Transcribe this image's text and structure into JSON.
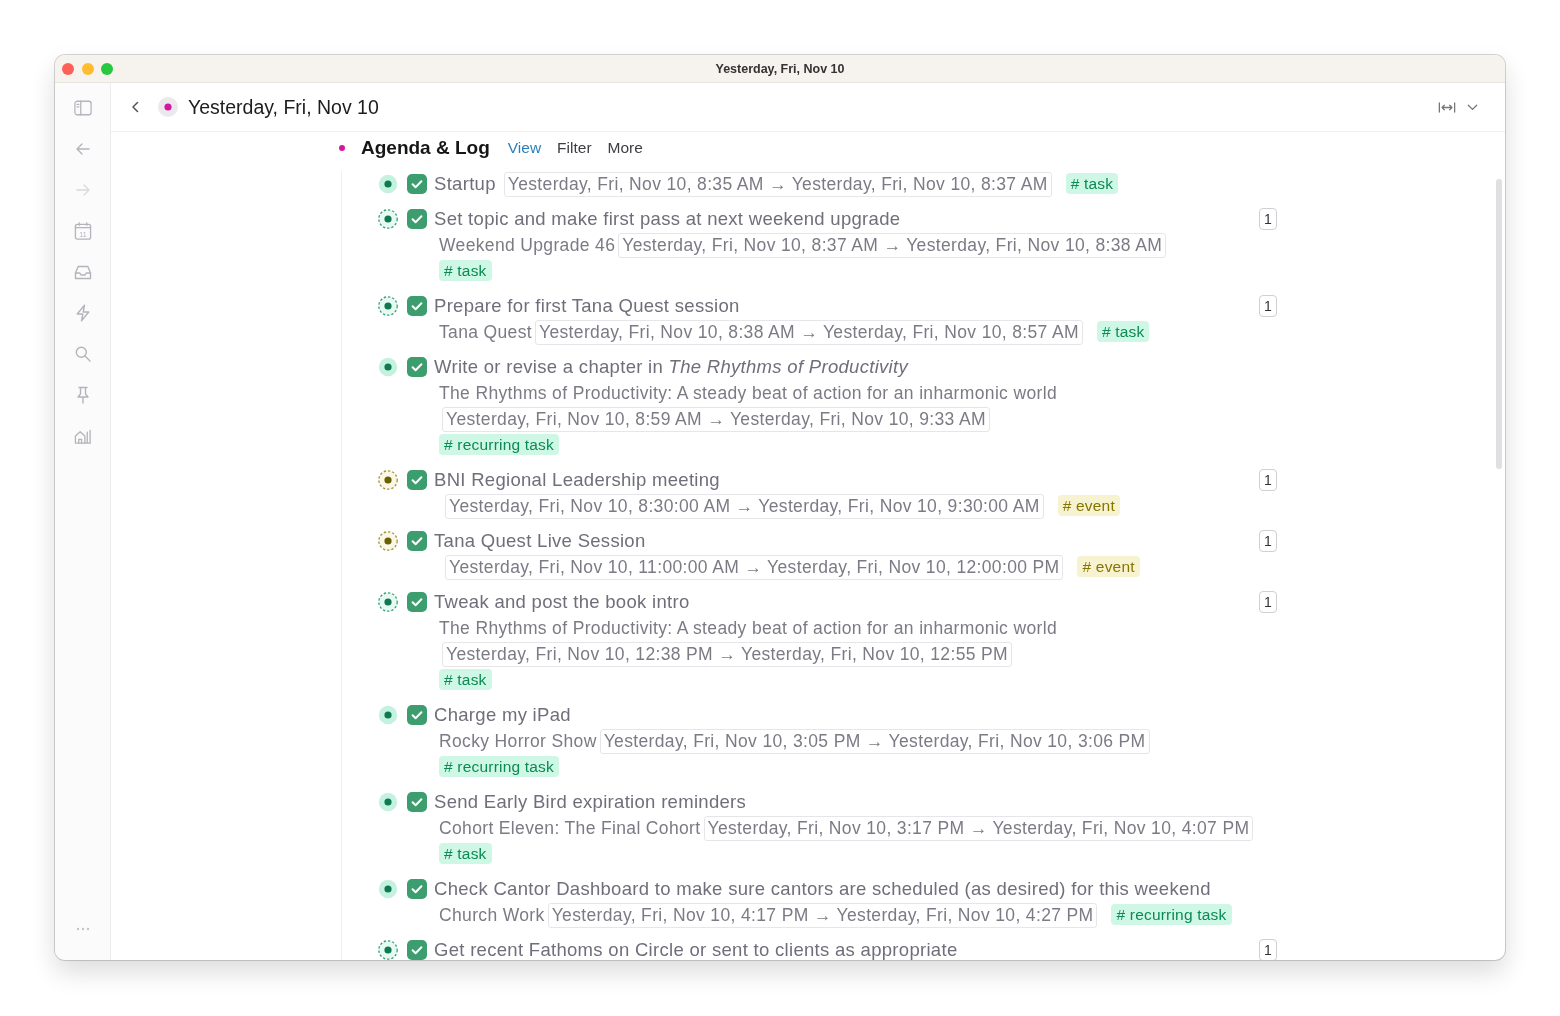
{
  "window": {
    "title": "Yesterday, Fri, Nov 10"
  },
  "sidebar": {
    "back": {
      "disabled": false
    },
    "forward": {
      "disabled": true
    },
    "calendar_day": "11"
  },
  "header": {
    "title": "Yesterday, Fri, Nov 10"
  },
  "section": {
    "title": "Agenda & Log",
    "controls": [
      {
        "label": "View",
        "selected": true
      },
      {
        "label": "Filter",
        "selected": false
      },
      {
        "label": "More",
        "selected": false
      }
    ]
  },
  "tasks": [
    {
      "bullet": {
        "kind": "filled",
        "color": "#0d7a4f"
      },
      "checked": true,
      "title": "Startup",
      "inline": [
        {
          "kind": "date",
          "text": "Yesterday, Fri, Nov 10, 8:35 AM → Yesterday, Fri, Nov 10, 8:37 AM"
        },
        {
          "kind": "tag",
          "text": "# task",
          "color": "#0b8a52"
        }
      ]
    },
    {
      "bullet": {
        "kind": "dashed",
        "color": "#0d7a4f"
      },
      "checked": true,
      "title": "Set topic and make first pass at next weekend upgrade",
      "count": "1",
      "lines": [
        [
          {
            "kind": "context",
            "text": "Weekend Upgrade 46"
          },
          {
            "kind": "date",
            "text": "Yesterday, Fri, Nov 10, 8:37 AM → Yesterday, Fri, Nov 10, 8:38 AM"
          }
        ],
        [
          {
            "kind": "tag",
            "text": "# task",
            "color": "#0b8a52"
          }
        ]
      ]
    },
    {
      "bullet": {
        "kind": "dashed",
        "color": "#0d7a4f"
      },
      "checked": true,
      "title": "Prepare for first Tana Quest session",
      "count": "1",
      "lines": [
        [
          {
            "kind": "context",
            "text": "Tana Quest"
          },
          {
            "kind": "date",
            "text": "Yesterday, Fri, Nov 10, 8:38 AM → Yesterday, Fri, Nov 10, 8:57 AM"
          },
          {
            "kind": "tag",
            "text": "# task",
            "color": "#0b8a52"
          }
        ]
      ]
    },
    {
      "bullet": {
        "kind": "filled",
        "color": "#0d7a4f"
      },
      "checked": true,
      "title": "Write or revise a chapter in *The Rhythms of Productivity*",
      "lines": [
        [
          {
            "kind": "context",
            "text": "The Rhythms of Productivity: A steady beat of action for an inharmonic world"
          },
          {
            "kind": "date",
            "text": "Yesterday, Fri, Nov 10, 8:59 AM → Yesterday, Fri, Nov 10, 9:33 AM"
          }
        ],
        [
          {
            "kind": "tag",
            "text": "# recurring task",
            "color": "#0b8a52"
          }
        ]
      ]
    },
    {
      "bullet": {
        "kind": "dashed",
        "color": "#6b5f00"
      },
      "checked": true,
      "title": "BNI Regional Leadership meeting",
      "count": "1",
      "lines": [
        [
          {
            "kind": "date",
            "text": "Yesterday, Fri, Nov 10, 8:30:00 AM → Yesterday, Fri, Nov 10, 9:30:00 AM"
          },
          {
            "kind": "tag",
            "text": "# event",
            "color": "#857400"
          }
        ]
      ]
    },
    {
      "bullet": {
        "kind": "dashed",
        "color": "#6b5f00"
      },
      "checked": true,
      "title": "Tana Quest Live Session",
      "count": "1",
      "lines": [
        [
          {
            "kind": "date",
            "text": "Yesterday, Fri, Nov 10, 11:00:00 AM → Yesterday, Fri, Nov 10, 12:00:00 PM"
          },
          {
            "kind": "tag",
            "text": "# event",
            "color": "#857400"
          }
        ]
      ]
    },
    {
      "bullet": {
        "kind": "dashed",
        "color": "#0d7a4f"
      },
      "checked": true,
      "title": "Tweak and post the book intro",
      "count": "1",
      "lines": [
        [
          {
            "kind": "context",
            "text": "The Rhythms of Productivity: A steady beat of action for an inharmonic world"
          },
          {
            "kind": "date",
            "text": "Yesterday, Fri, Nov 10, 12:38 PM → Yesterday, Fri, Nov 10, 12:55 PM"
          }
        ],
        [
          {
            "kind": "tag",
            "text": "# task",
            "color": "#0b8a52"
          }
        ]
      ]
    },
    {
      "bullet": {
        "kind": "filled",
        "color": "#0d7a4f"
      },
      "checked": true,
      "title": "Charge my iPad",
      "lines": [
        [
          {
            "kind": "context",
            "text": "Rocky Horror Show"
          },
          {
            "kind": "date",
            "text": "Yesterday, Fri, Nov 10, 3:05 PM → Yesterday, Fri, Nov 10, 3:06 PM"
          }
        ],
        [
          {
            "kind": "tag",
            "text": "# recurring task",
            "color": "#0b8a52"
          }
        ]
      ]
    },
    {
      "bullet": {
        "kind": "filled",
        "color": "#0d7a4f"
      },
      "checked": true,
      "title": "Send Early Bird expiration reminders",
      "lines": [
        [
          {
            "kind": "context",
            "text": "Cohort Eleven: The Final Cohort"
          },
          {
            "kind": "date",
            "text": "Yesterday, Fri, Nov 10, 3:17 PM → Yesterday, Fri, Nov 10, 4:07 PM"
          }
        ],
        [
          {
            "kind": "tag",
            "text": "# task",
            "color": "#0b8a52"
          }
        ]
      ]
    },
    {
      "bullet": {
        "kind": "filled",
        "color": "#0d7a4f"
      },
      "checked": true,
      "title": "Check Cantor Dashboard to make sure cantors are scheduled (as desired) for this weekend",
      "lines": [
        [
          {
            "kind": "context",
            "text": "Church Work"
          },
          {
            "kind": "date",
            "text": "Yesterday, Fri, Nov 10, 4:17 PM → Yesterday, Fri, Nov 10, 4:27 PM"
          },
          {
            "kind": "tag",
            "text": "# recurring task",
            "color": "#0b8a52"
          }
        ]
      ]
    },
    {
      "bullet": {
        "kind": "dashed",
        "color": "#0d7a4f"
      },
      "checked": true,
      "title": "Get recent Fathoms on Circle or sent to clients as appropriate",
      "count": "1"
    }
  ]
}
